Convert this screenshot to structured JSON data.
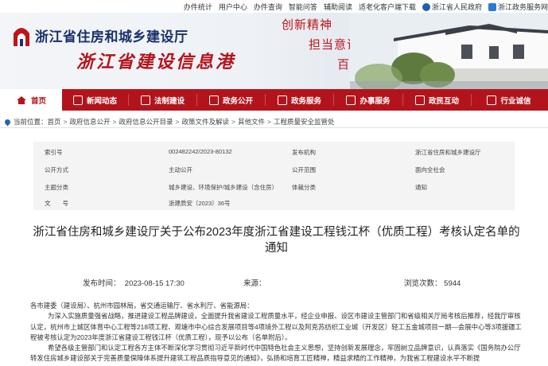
{
  "topbar": {
    "links": [
      "办件统计",
      "用户中心",
      "办件查询",
      "智能问答",
      "辅助阅读",
      "适老化客户端下载"
    ],
    "gov_links": [
      "浙江省人民政府",
      "浙江政务服务网"
    ]
  },
  "banner": {
    "org_name": "浙江省住房和城乡建设厅",
    "site_name": "浙江省建设信息港",
    "slogans": [
      "创新精神",
      "担当意识",
      "百姓情怀"
    ]
  },
  "nav": {
    "items": [
      {
        "label": "首页",
        "icon": "home-icon"
      },
      {
        "label": "新闻动态",
        "icon": "news-icon"
      },
      {
        "label": "法制建设",
        "icon": "law-icon"
      },
      {
        "label": "政务公开",
        "icon": "disclosure-icon"
      },
      {
        "label": "政务服务",
        "icon": "service-icon"
      },
      {
        "label": "办事服务",
        "icon": "affairs-icon"
      },
      {
        "label": "政民互动",
        "icon": "interaction-icon"
      },
      {
        "label": "行业诚信",
        "icon": "integrity-icon"
      }
    ]
  },
  "breadcrumb": {
    "label": "当前位置：",
    "items": [
      "首页",
      "政府信息公开",
      "政府信息公开目录",
      "政策文件及解读",
      "其他文件",
      "工程质量安全监管处"
    ]
  },
  "meta": {
    "index_label": "索引号",
    "index_value": "002482242/2023-80132",
    "org_label": "发布机构",
    "org_value": "浙江省住房和城乡建设厅",
    "method_label": "公开方式",
    "method_value": "主动公开",
    "scope_label": "公开范围",
    "scope_value": "面向全社会",
    "topic_label": "主题分类",
    "topic_value": "城乡建设、环境保护/城乡建设（含住房）",
    "genre_label": "体裁分类",
    "genre_value": "通知",
    "docno_label": "文　　号",
    "docno_value": "浙建质安〔2023〕36号"
  },
  "article": {
    "title": "浙江省住房和城乡建设厅关于公布2023年度浙江省建设工程钱江杯（优质工程）考核认定名单的通知",
    "publish_label": "发布时间：",
    "publish_time": "2023-08-15 17:30",
    "source_label": "来源：",
    "source_value": "",
    "views_label": "浏览次数：",
    "views": "5944",
    "salutation": "各市建委（建设局）、杭州市园林局，省交通运输厅、省水利厅、省能源局：",
    "para1": "为深入实施质量强省战略，推进建设工程品牌建设，全面提升我省建设工程质量水平，经企业申报、设区市建设主管部门和省级相关厅局考核后推荐，经我厅审核认定，杭州市上城区体育中心工程等218项工程、观塘市中心综合发展项目等4项境外工程以及阿克苏纺织工业城（开发区）轻工五金城项目一期—会展中心等3项援疆工程被考核认定为2023年度浙江省建设工程钱江杯（优质工程），现予以公布（名单附后）。",
    "para2": "希望各级主管部门和认定工程各方主体不断深化学习贯彻习近平新时代中国特色社会主义思想，坚持创新发展理念，牢固树立品牌意识，认真落实《国务院办公厅转发住房城乡建设部关于完善质量保障体系提升建筑工程品质指导意见的通知》，弘扬和培育工匠精神，精益求精的工作精神，为我省工程建设水平不断提"
  }
}
